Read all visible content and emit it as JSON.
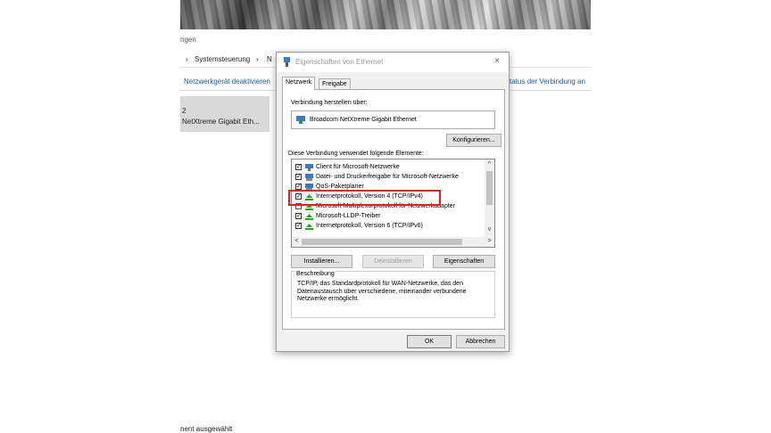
{
  "background": {
    "partial_title": "ngen",
    "breadcrumb_sep": "›",
    "breadcrumb_item": "Systemsteuerung",
    "breadcrumb_sep2": "›",
    "breadcrumb_partial": "N",
    "toolbar_left": "Netzwerkgerät deaktivieren",
    "toolbar_right": "tatus der Verbindung an",
    "adapter_line1": "2",
    "adapter_line2": "NetXtreme Gigabit Eth...",
    "status_bar": "nent ausgewählt"
  },
  "dialog": {
    "title": "Eigenschaften von Ethernet",
    "close_icon": "×",
    "tabs": [
      {
        "label": "Netzwerk",
        "active": true
      },
      {
        "label": "Freigabe",
        "active": false
      }
    ],
    "connect_using_label": "Verbindung herstellen über:",
    "adapter_name": "Broadcom NetXtreme Gigabit Ethernet",
    "configure_button": "Konfigurieren...",
    "items_label": "Diese Verbindung verwendet folgende Elemente:",
    "items": [
      {
        "label": "Client für Microsoft-Netzwerke",
        "checked": true,
        "icon": "network-client-icon"
      },
      {
        "label": "Datei- und Druckerfreigabe für Microsoft-Netzwerke",
        "checked": true,
        "icon": "network-service-icon"
      },
      {
        "label": "QoS-Paketplaner",
        "checked": true,
        "icon": "network-service-icon"
      },
      {
        "label": "Internetprotokoll, Version 4 (TCP/IPv4)",
        "checked": true,
        "icon": "protocol-icon"
      },
      {
        "label": "Microsoft-Multiplexorprotokoll für Netzwerkadapter",
        "checked": false,
        "icon": "protocol-icon"
      },
      {
        "label": "Microsoft-LLDP-Treiber",
        "checked": true,
        "icon": "protocol-icon"
      },
      {
        "label": "Internetprotokoll, Version 6 (TCP/IPv6)",
        "checked": true,
        "icon": "protocol-icon"
      }
    ],
    "checkmark": "✓",
    "scroll_up": "^",
    "scroll_down": "v",
    "scroll_left": "<",
    "scroll_right": ">",
    "install_button": "Installieren...",
    "uninstall_button": "Deinstallieren",
    "properties_button": "Eigenschaften",
    "description_title": "Beschreibung",
    "description_text": "TCP/IP, das Standardprotokoll für WAN-Netzwerke, das den Datenaustausch über verschiedene, miteinander verbundene Netzwerke ermöglicht.",
    "ok_button": "OK",
    "cancel_button": "Abbrechen"
  },
  "colors": {
    "highlight_border": "#e02020",
    "protocol_icon": "#2aa02a",
    "network_icon": "#3a78c8"
  }
}
